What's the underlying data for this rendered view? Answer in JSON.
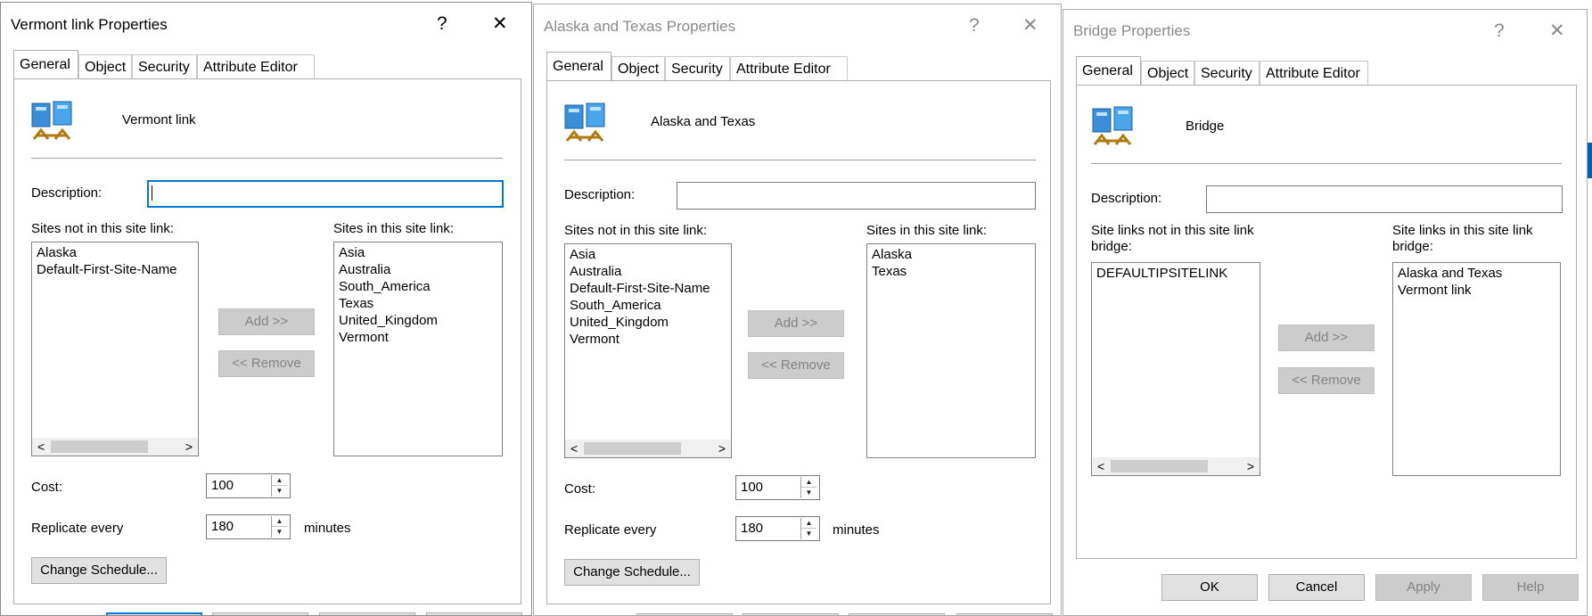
{
  "windows": [
    {
      "title": "Vermont link Properties",
      "help_glyph": "?",
      "close_glyph": "✕",
      "tabs": [
        "General",
        "Object",
        "Security",
        "Attribute Editor"
      ],
      "object_name": "Vermont link",
      "icon": "site-link-icon",
      "description_label": "Description:",
      "description_value": "",
      "left_list_label": "Sites not in this site link:",
      "left_list_items": [
        "Alaska",
        "Default-First-Site-Name"
      ],
      "right_list_label": "Sites in this site link:",
      "right_list_items": [
        "Asia",
        "Australia",
        "South_America",
        "Texas",
        "United_Kingdom",
        "Vermont"
      ],
      "add_label": "Add >>",
      "remove_label": "<< Remove",
      "cost_label": "Cost:",
      "cost_value": "100",
      "replicate_label": "Replicate every",
      "replicate_value": "180",
      "minutes_label": "minutes",
      "change_schedule_label": "Change Schedule...",
      "scroll_left": "<",
      "scroll_right": ">"
    },
    {
      "title": "Alaska and Texas Properties",
      "help_glyph": "?",
      "close_glyph": "✕",
      "tabs": [
        "General",
        "Object",
        "Security",
        "Attribute Editor"
      ],
      "object_name": "Alaska and Texas",
      "icon": "site-link-icon",
      "description_label": "Description:",
      "description_value": "",
      "left_list_label": "Sites not in this site link:",
      "left_list_items": [
        "Asia",
        "Australia",
        "Default-First-Site-Name",
        "South_America",
        "United_Kingdom",
        "Vermont"
      ],
      "right_list_label": "Sites in this site link:",
      "right_list_items": [
        "Alaska",
        "Texas"
      ],
      "add_label": "Add >>",
      "remove_label": "<< Remove",
      "cost_label": "Cost:",
      "cost_value": "100",
      "replicate_label": "Replicate every",
      "replicate_value": "180",
      "minutes_label": "minutes",
      "change_schedule_label": "Change Schedule...",
      "scroll_left": "<",
      "scroll_right": ">"
    },
    {
      "title": "Bridge Properties",
      "help_glyph": "?",
      "close_glyph": "✕",
      "tabs": [
        "General",
        "Object",
        "Security",
        "Attribute Editor"
      ],
      "object_name": "Bridge",
      "icon": "site-link-bridge-icon",
      "description_label": "Description:",
      "description_value": "",
      "left_list_label": "Site links not in this site link bridge:",
      "left_list_items": [
        "DEFAULTIPSITELINK"
      ],
      "right_list_label": "Site links in this site link bridge:",
      "right_list_items": [
        "Alaska and Texas",
        "Vermont link"
      ],
      "add_label": "Add >>",
      "remove_label": "<< Remove",
      "scroll_left": "<",
      "scroll_right": ">",
      "ok_label": "OK",
      "cancel_label": "Cancel",
      "apply_label": "Apply",
      "help_label": "Help"
    }
  ],
  "colors": {
    "focus_border": "#0078d7",
    "desktop_accent": "#0063b1"
  }
}
